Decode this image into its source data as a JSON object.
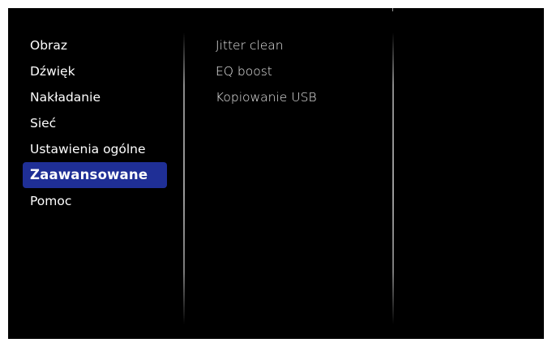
{
  "menu": {
    "items": [
      {
        "label": "Obraz"
      },
      {
        "label": "Dźwięk"
      },
      {
        "label": "Nakładanie"
      },
      {
        "label": "Sieć"
      },
      {
        "label": "Ustawienia ogólne"
      },
      {
        "label": "Zaawansowane",
        "selected": true
      },
      {
        "label": "Pomoc"
      }
    ],
    "selected_label": "Zaawansowane"
  },
  "submenu": {
    "items": [
      {
        "label": "Jitter clean"
      },
      {
        "label": "EQ boost"
      },
      {
        "label": "Kopiowanie USB"
      }
    ]
  },
  "colors": {
    "background": "#000000",
    "highlight": "#1f2f96",
    "text": "#ffffff"
  }
}
